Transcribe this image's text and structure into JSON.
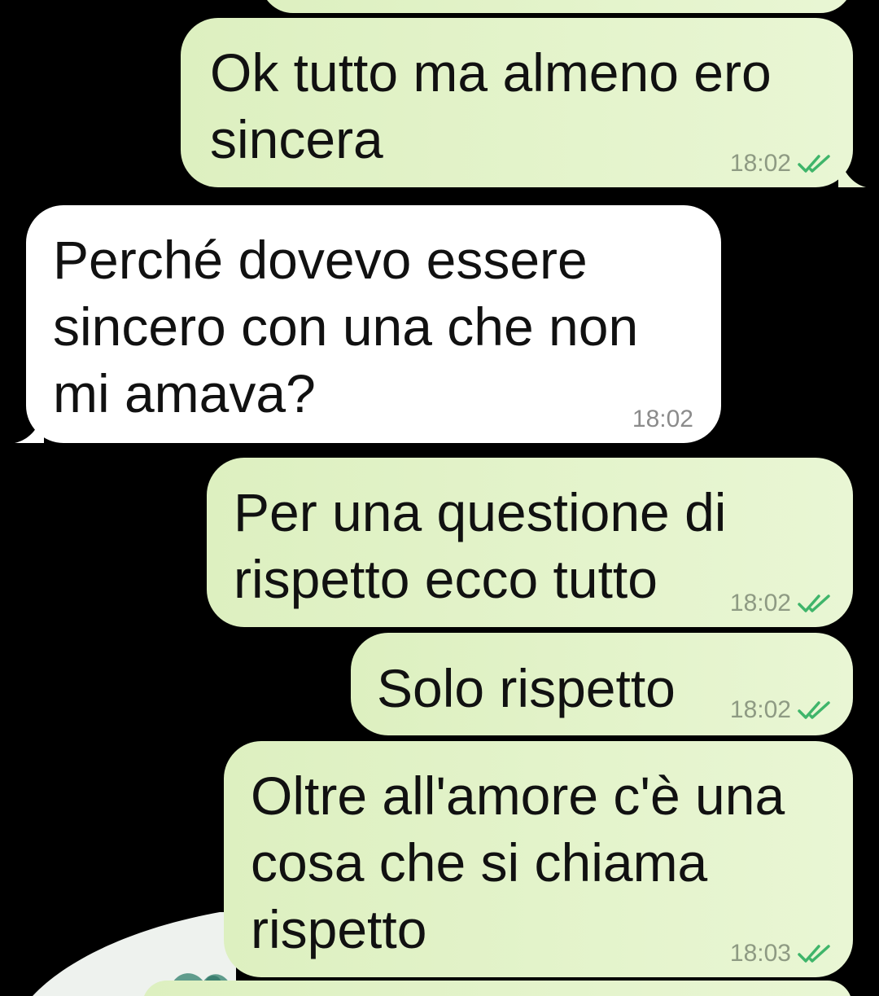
{
  "conversation": {
    "messages": [
      {
        "direction": "outgoing",
        "text": "Ok tutto ma almeno ero\nsincera",
        "time": "18:02",
        "status_icon": "double-check-read-icon"
      },
      {
        "direction": "incoming",
        "text": "Perché dovevo essere\nsincero con una che non\nmi amava?",
        "time": "18:02"
      },
      {
        "direction": "outgoing",
        "text": "Per una questione di\nrispetto ecco tutto",
        "time": "18:02",
        "status_icon": "double-check-read-icon"
      },
      {
        "direction": "outgoing",
        "text": "Solo rispetto",
        "time": "18:02",
        "status_icon": "double-check-read-icon"
      },
      {
        "direction": "outgoing",
        "text": "Oltre all'amore c'è una\ncosa che si chiama\nrispetto",
        "time": "18:03",
        "status_icon": "double-check-read-icon"
      }
    ]
  },
  "colors": {
    "background": "#000000",
    "outgoing_bubble": "#e3f4c9",
    "incoming_bubble": "#ffffff",
    "read_ticks": "#3fb56a",
    "timestamp": "#8e9a83"
  }
}
